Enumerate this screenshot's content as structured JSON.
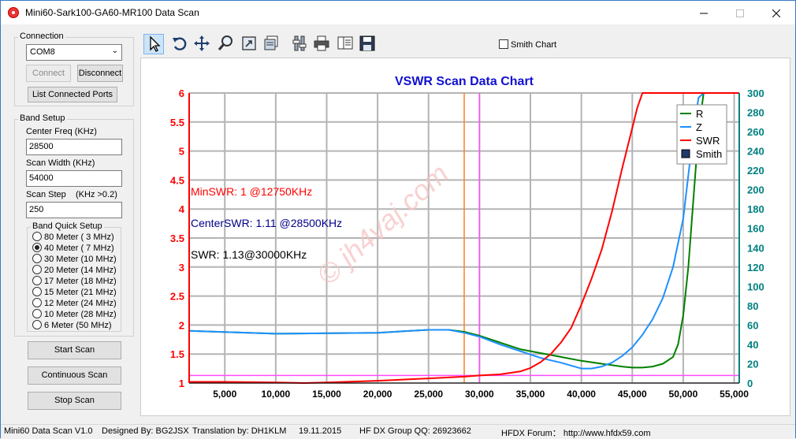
{
  "window": {
    "title": "Mini60-Sark100-GA60-MR100 Data Scan"
  },
  "connection": {
    "group_label": "Connection",
    "port": "COM8",
    "connect_label": "Connect",
    "disconnect_label": "Disconnect",
    "list_ports_label": "List Connected Ports"
  },
  "band_setup": {
    "group_label": "Band Setup",
    "center_freq_label": "Center Freq  (KHz)",
    "center_freq_value": "28500",
    "scan_width_label": "Scan Width   (KHz)",
    "scan_width_value": "54000",
    "scan_step_label": "Scan Step",
    "scan_step_hint": "(KHz >0.2)",
    "scan_step_value": "250",
    "quick_setup_label": "Band Quick Setup",
    "bands": [
      {
        "label": "80 Meter (  3 MHz)",
        "checked": false
      },
      {
        "label": "40 Meter (  7 MHz)",
        "checked": true
      },
      {
        "label": "30 Meter (10 MHz)",
        "checked": false
      },
      {
        "label": "20 Meter (14 MHz)",
        "checked": false
      },
      {
        "label": "17 Meter (18 MHz)",
        "checked": false
      },
      {
        "label": "15 Meter (21 MHz)",
        "checked": false
      },
      {
        "label": "12 Meter (24 MHz)",
        "checked": false
      },
      {
        "label": "10 Meter (28 MHz)",
        "checked": false
      },
      {
        "label": "6 Meter  (50 MHz)",
        "checked": false
      }
    ]
  },
  "actions": {
    "start_scan": "Start Scan",
    "continuous_scan": "Continuous Scan",
    "stop_scan": "Stop Scan"
  },
  "toolbar": {
    "smith_chart_label": "Smith Chart",
    "icons": [
      "pointer-icon",
      "undo-icon",
      "pan-icon",
      "zoom-icon",
      "export-icon",
      "copy-icon",
      "settings-icon",
      "print-icon",
      "print-preview-icon",
      "save-icon"
    ]
  },
  "chart_data": {
    "type": "line",
    "title": "VSWR Scan Data Chart",
    "x_ticks": [
      "5,000",
      "10,000",
      "15,000",
      "20,000",
      "25,000",
      "30,000",
      "35,000",
      "40,000",
      "45,000",
      "50,000",
      "55,000"
    ],
    "xlim": [
      1500,
      55500
    ],
    "y_left_ticks": [
      "1",
      "1.5",
      "2",
      "2.5",
      "3",
      "3.5",
      "4",
      "4.5",
      "5",
      "5.5",
      "6"
    ],
    "ylim_left": [
      1,
      6
    ],
    "y_right_ticks": [
      "0",
      "20",
      "40",
      "60",
      "80",
      "100",
      "120",
      "140",
      "160",
      "180",
      "200",
      "220",
      "240",
      "260",
      "280",
      "300"
    ],
    "ylim_right": [
      0,
      300
    ],
    "legend_position": "top-right",
    "legend": [
      {
        "name": "R",
        "color": "#008000",
        "marker": "line"
      },
      {
        "name": "Z",
        "color": "#1e90ff",
        "marker": "line"
      },
      {
        "name": "SWR",
        "color": "#ff0000",
        "marker": "line"
      },
      {
        "name": "Smith",
        "color": "#1f3a6e",
        "marker": "box"
      }
    ],
    "annotations": [
      {
        "text": "MinSWR: 1 @12750KHz",
        "color": "#ff0000"
      },
      {
        "text": "CenterSWR: 1.11 @28500KHz",
        "color": "#00008b"
      },
      {
        "text": "SWR: 1.13@30000KHz",
        "color": "#000000"
      }
    ],
    "markers": {
      "center_x": 28500,
      "cursor_x": 30000,
      "swr_ref_y": 1.13
    },
    "series": [
      {
        "name": "SWR",
        "color": "#ff0000",
        "axis": "left",
        "x": [
          1500,
          5000,
          10000,
          12750,
          15000,
          20000,
          25000,
          28500,
          30000,
          32000,
          34000,
          35000,
          36000,
          37000,
          38000,
          39000,
          40000,
          41000,
          42000,
          43000,
          44000,
          45000,
          45500,
          46000,
          46500,
          55500
        ],
        "y": [
          1.02,
          1.02,
          1.01,
          1.0,
          1.01,
          1.04,
          1.08,
          1.11,
          1.13,
          1.15,
          1.2,
          1.26,
          1.36,
          1.5,
          1.7,
          1.95,
          2.35,
          2.8,
          3.3,
          3.95,
          4.7,
          5.4,
          5.75,
          6.0,
          6.0,
          6.0
        ]
      },
      {
        "name": "R",
        "color": "#008000",
        "axis": "right",
        "x": [
          1500,
          10000,
          20000,
          25000,
          27000,
          28500,
          30000,
          32000,
          34000,
          36000,
          38000,
          40000,
          42000,
          44000,
          45000,
          46000,
          47000,
          48000,
          49000,
          49500,
          50000,
          50500,
          51000,
          51500,
          52000,
          55500
        ],
        "y": [
          54,
          51,
          52,
          55,
          55,
          53,
          49,
          42,
          35,
          31,
          27,
          23,
          20,
          17,
          16,
          16,
          17,
          20,
          27,
          40,
          70,
          120,
          190,
          260,
          300,
          300
        ]
      },
      {
        "name": "Z",
        "color": "#1e90ff",
        "axis": "right",
        "x": [
          1500,
          10000,
          20000,
          25000,
          27000,
          28500,
          30000,
          32000,
          34000,
          36000,
          38000,
          40000,
          41000,
          42000,
          43000,
          44000,
          45000,
          46000,
          47000,
          48000,
          49000,
          50000,
          50500,
          51000,
          51500,
          52000,
          55500
        ],
        "y": [
          54,
          51,
          52,
          55,
          55,
          52,
          48,
          40,
          33,
          26,
          21,
          15,
          15,
          17,
          21,
          28,
          37,
          50,
          66,
          88,
          120,
          170,
          215,
          260,
          295,
          300,
          300
        ]
      }
    ]
  },
  "watermark": "© jh4vaj.com",
  "status": {
    "version": "Mini60 Data Scan V1.0",
    "designer": "Designed By: BG2JSX",
    "translator": "Translation by: DH1KLM",
    "date": "19.11.2015",
    "group": "HF DX Group QQ: 26923662",
    "forum": "HFDX Forum：  http://www.hfdx59.com"
  }
}
